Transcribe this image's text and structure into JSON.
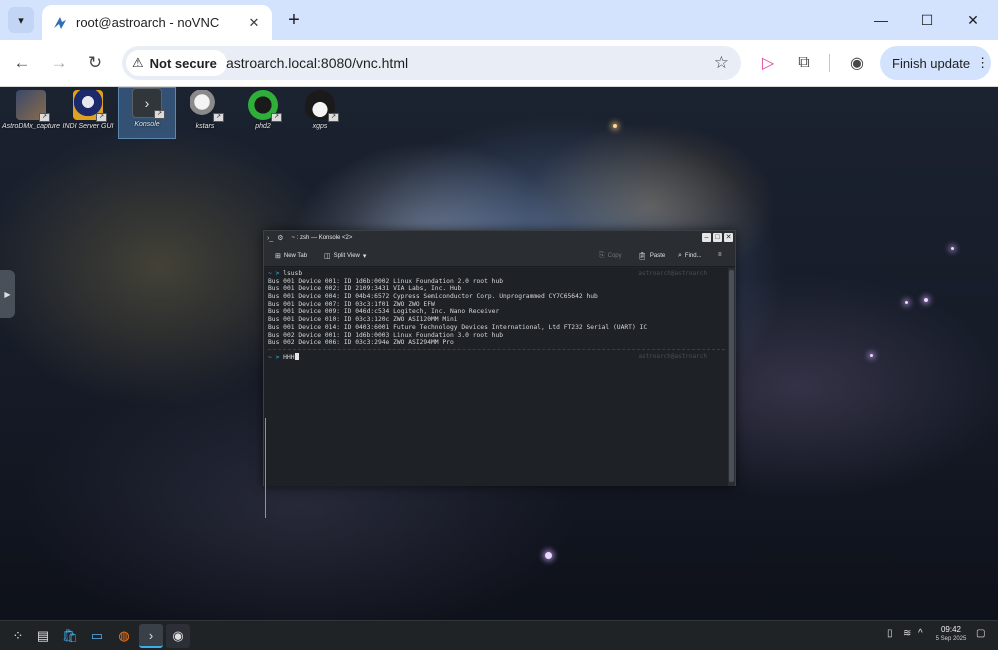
{
  "browser": {
    "tab_title": "root@astroarch - noVNC",
    "new_tab_label": "+",
    "security_label": "Not secure",
    "url": "astroarch.local:8080/vnc.html",
    "finish_update_label": "Finish update",
    "icons": {
      "tab_list": "▾",
      "tab_close": "✕",
      "minimize": "—",
      "maximize": "☐",
      "close": "✕",
      "back": "←",
      "forward": "→",
      "reload": "↻",
      "warning": "⚠",
      "bookmark": "☆",
      "extension_puzzle": "⧉",
      "menu": "⋮",
      "profile": "◉",
      "media": "▷"
    }
  },
  "desktop": {
    "icons": [
      {
        "label": "AstroDMx_capture"
      },
      {
        "label": "INDI Server GUI"
      },
      {
        "label": "Konsole"
      },
      {
        "label": "kstars"
      },
      {
        "label": "phd2"
      },
      {
        "label": "xgps"
      }
    ],
    "link_badge": "↗"
  },
  "konsole": {
    "title": "~ : zsh — Konsole <2>",
    "toolbar": {
      "new_tab": "New Tab",
      "split_view": "Split View",
      "copy": "Copy",
      "paste": "Paste",
      "find": "Find..."
    },
    "prompt": "~ >",
    "command": "lsusb",
    "host_right": "astroarch@astroarch",
    "output": [
      "Bus 001 Device 001: ID 1d6b:0002 Linux Foundation 2.0 root hub",
      "Bus 001 Device 002: ID 2109:3431 VIA Labs, Inc. Hub",
      "Bus 001 Device 004: ID 04b4:6572 Cypress Semiconductor Corp. Unprogrammed CY7C65642 hub",
      "Bus 001 Device 007: ID 03c3:1f01 ZWO ZWO EFW",
      "Bus 001 Device 009: ID 046d:c534 Logitech, Inc. Nano Receiver",
      "Bus 001 Device 010: ID 03c3:120c ZWO ASI120MM Mini",
      "Bus 001 Device 014: ID 0403:6001 Future Technology Devices International, Ltd FT232 Serial (UART) IC",
      "Bus 002 Device 001: ID 1d6b:0003 Linux Foundation 3.0 root hub",
      "Bus 002 Device 006: ID 03c3:294e ZWO ASI294MM Pro"
    ],
    "current_input": "HHH"
  },
  "taskbar": {
    "time": "09:42",
    "date": "5 Sep 2025"
  }
}
